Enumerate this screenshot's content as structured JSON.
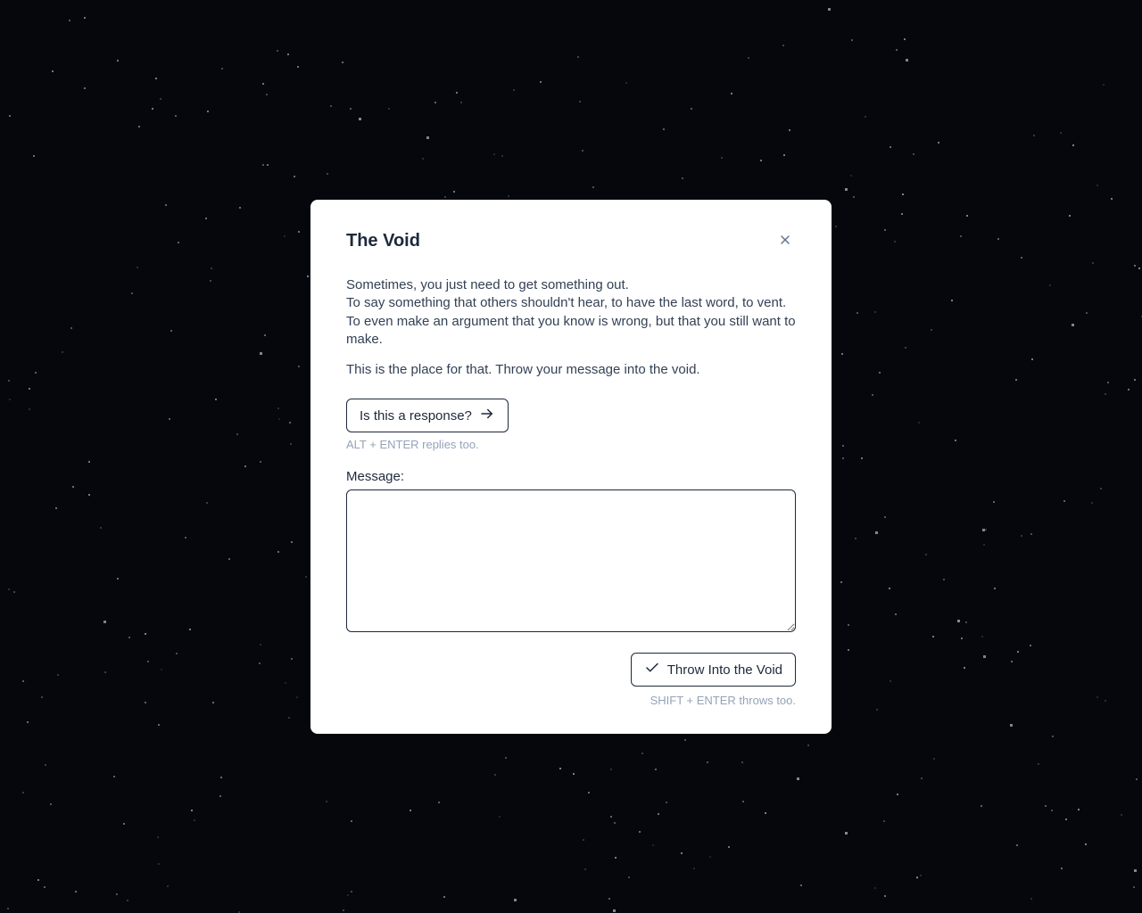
{
  "modal": {
    "title": "The Void",
    "intro_line1": "Sometimes, you just need to get something out.",
    "intro_line2": "To say something that others shouldn't hear, to have the last word, to vent.",
    "intro_line3": "To even make an argument that you know is wrong, but that you still want to make.",
    "intro_line4": "This is the place for that. Throw your message into the void.",
    "response_button": "Is this a response?",
    "response_hint": "ALT + ENTER replies too.",
    "message_label": "Message:",
    "throw_button": "Throw Into the Void",
    "throw_hint": "SHIFT + ENTER throws too."
  }
}
